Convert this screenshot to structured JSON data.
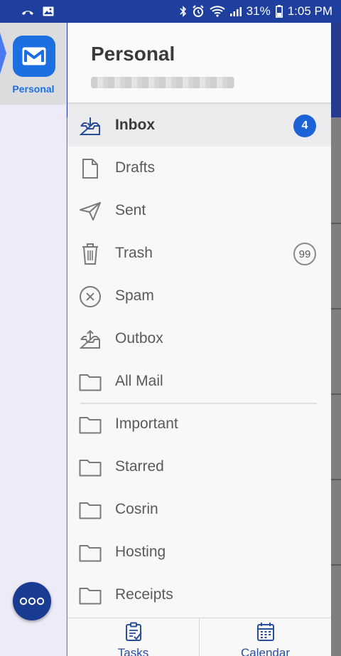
{
  "status_bar": {
    "battery": "31%",
    "time": "1:05 PM"
  },
  "account_rail": {
    "active_account_label": "Personal",
    "icons": {
      "account": "mail-m-icon",
      "more": "more-dots-icon"
    }
  },
  "drawer": {
    "title": "Personal",
    "email_blurred": true,
    "folders": [
      {
        "label": "Inbox",
        "icon": "inbox-icon",
        "badge": "4",
        "active": true
      },
      {
        "label": "Drafts",
        "icon": "draft-icon"
      },
      {
        "label": "Sent",
        "icon": "send-icon"
      },
      {
        "label": "Trash",
        "icon": "trash-icon",
        "badge": "99"
      },
      {
        "label": "Spam",
        "icon": "spam-icon"
      },
      {
        "label": "Outbox",
        "icon": "outbox-icon"
      },
      {
        "label": "All Mail",
        "icon": "folder-icon"
      }
    ],
    "labels": [
      {
        "label": "Important",
        "icon": "folder-icon"
      },
      {
        "label": "Starred",
        "icon": "folder-icon"
      },
      {
        "label": "Cosrin",
        "icon": "folder-icon"
      },
      {
        "label": "Hosting",
        "icon": "folder-icon"
      },
      {
        "label": "Receipts",
        "icon": "folder-icon"
      }
    ]
  },
  "bottom_bar": {
    "tabs": [
      {
        "label": "Tasks",
        "icon": "tasks-icon"
      },
      {
        "label": "Calendar",
        "icon": "calendar-icon"
      }
    ]
  },
  "colors": {
    "status_bar": "#1f3f9e",
    "accent": "#1b6fe0",
    "badge": "#1b63d6",
    "fab": "#1a3b92"
  }
}
